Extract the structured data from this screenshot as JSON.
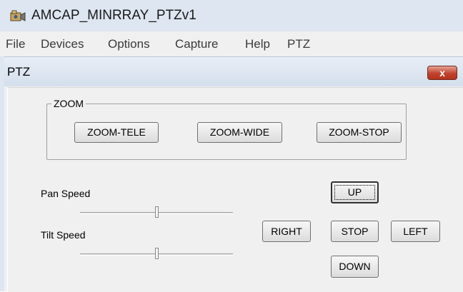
{
  "app": {
    "title": "AMCAP_MINRRAY_PTZv1"
  },
  "menu": {
    "items": [
      "File",
      "Devices",
      "Options",
      "Capture",
      "Help",
      "PTZ"
    ]
  },
  "dialog": {
    "title": "PTZ",
    "close_glyph": "x",
    "zoom_group": {
      "label": "ZOOM",
      "tele": "ZOOM-TELE",
      "wide": "ZOOM-WIDE",
      "stop": "ZOOM-STOP"
    },
    "pan_speed": {
      "label": "Pan Speed",
      "value_fraction": 0.5
    },
    "tilt_speed": {
      "label": "Tilt Speed",
      "value_fraction": 0.5
    },
    "directions": {
      "up": "UP",
      "right": "RIGHT",
      "stop": "STOP",
      "left": "LEFT",
      "down": "DOWN"
    }
  }
}
